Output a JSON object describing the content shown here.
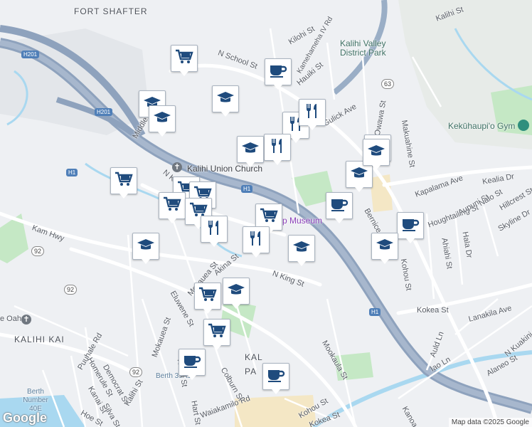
{
  "labels": {
    "fort_shafter": "FORT SHAFTER",
    "kalihi_valley_park": "Kalihi Valley District Park",
    "kekuhaupio_gym": "Kekūhaupi'o Gym",
    "kalihi_union_church": "Kalihi Union Church",
    "museum": "p Museum",
    "kalihi_kai": "KALIHI KAI",
    "kalihi_park": "KAL PA",
    "berth_40e": "Berth Number 40E",
    "berth_39a1": "Berth 39A1",
    "oahu": "e Oahu"
  },
  "streets": [
    "N School St",
    "Kilohi St",
    "Kamehameha IV Rd",
    "Hauiki St",
    "Gulick Ave",
    "Owawa St",
    "Makuahine St",
    "Kalihi St",
    "Kealia Dr",
    "Kapalama Ave",
    "Bernice St",
    "Houghtailing St",
    "Aupuni St",
    "Nalo St",
    "Skyline Dr",
    "Hillcrest St",
    "Hala Dr",
    "Ahiahi St",
    "Kohou St",
    "Kokea St",
    "Lanakila Ave",
    "Auld Ln",
    "Iao Ln",
    "Alaneo St",
    "N Kuakini",
    "N King St",
    "Kam Hwy",
    "Akina St",
    "Mokauea St",
    "Eluwene St",
    "Puuhale Rd",
    "Homerule St",
    "Democrat St",
    "Kanai St",
    "Hoe St",
    "Silva St",
    "Kalihi St",
    "Kaiwi St",
    "Hart St",
    "Colburn St",
    "Waiakamilo Rd",
    "Mookaula St",
    "Mokauea St",
    "Middle St",
    "N King St",
    "Dillingham Blvd",
    "Kohou St",
    "Kokea St",
    "Kanoa"
  ],
  "shields": {
    "h201a": "H201",
    "h201b": "H201",
    "h1a": "H1",
    "h1b": "H1",
    "h1c": "H1",
    "r92a": "92",
    "r92b": "92",
    "r92c": "92",
    "r63": "63"
  },
  "attribution": "Map data ©2025 Google",
  "logo": "Google",
  "markers": [
    {
      "type": "grocery"
    },
    {
      "type": "cafe"
    },
    {
      "type": "school"
    },
    {
      "type": "school"
    },
    {
      "type": "school"
    },
    {
      "type": "restaurant"
    },
    {
      "type": "restaurant"
    },
    {
      "type": "restaurant"
    },
    {
      "type": "school"
    },
    {
      "type": "cafe"
    },
    {
      "type": "school"
    },
    {
      "type": "grocery"
    },
    {
      "type": "grocery"
    },
    {
      "type": "grocery"
    },
    {
      "type": "cafe"
    },
    {
      "type": "school"
    },
    {
      "type": "cafe"
    },
    {
      "type": "school"
    },
    {
      "type": "grocery"
    },
    {
      "type": "grocery"
    },
    {
      "type": "grocery"
    },
    {
      "type": "restaurant"
    },
    {
      "type": "restaurant"
    },
    {
      "type": "grocery"
    },
    {
      "type": "school"
    },
    {
      "type": "grocery"
    },
    {
      "type": "school"
    },
    {
      "type": "school"
    },
    {
      "type": "cafe"
    },
    {
      "type": "cafe"
    }
  ],
  "colors": {
    "freeway": "#8ea2bd",
    "water": "#a9d8f0",
    "park": "#c5e8c5",
    "marker_icon": "#1f4b7d"
  }
}
